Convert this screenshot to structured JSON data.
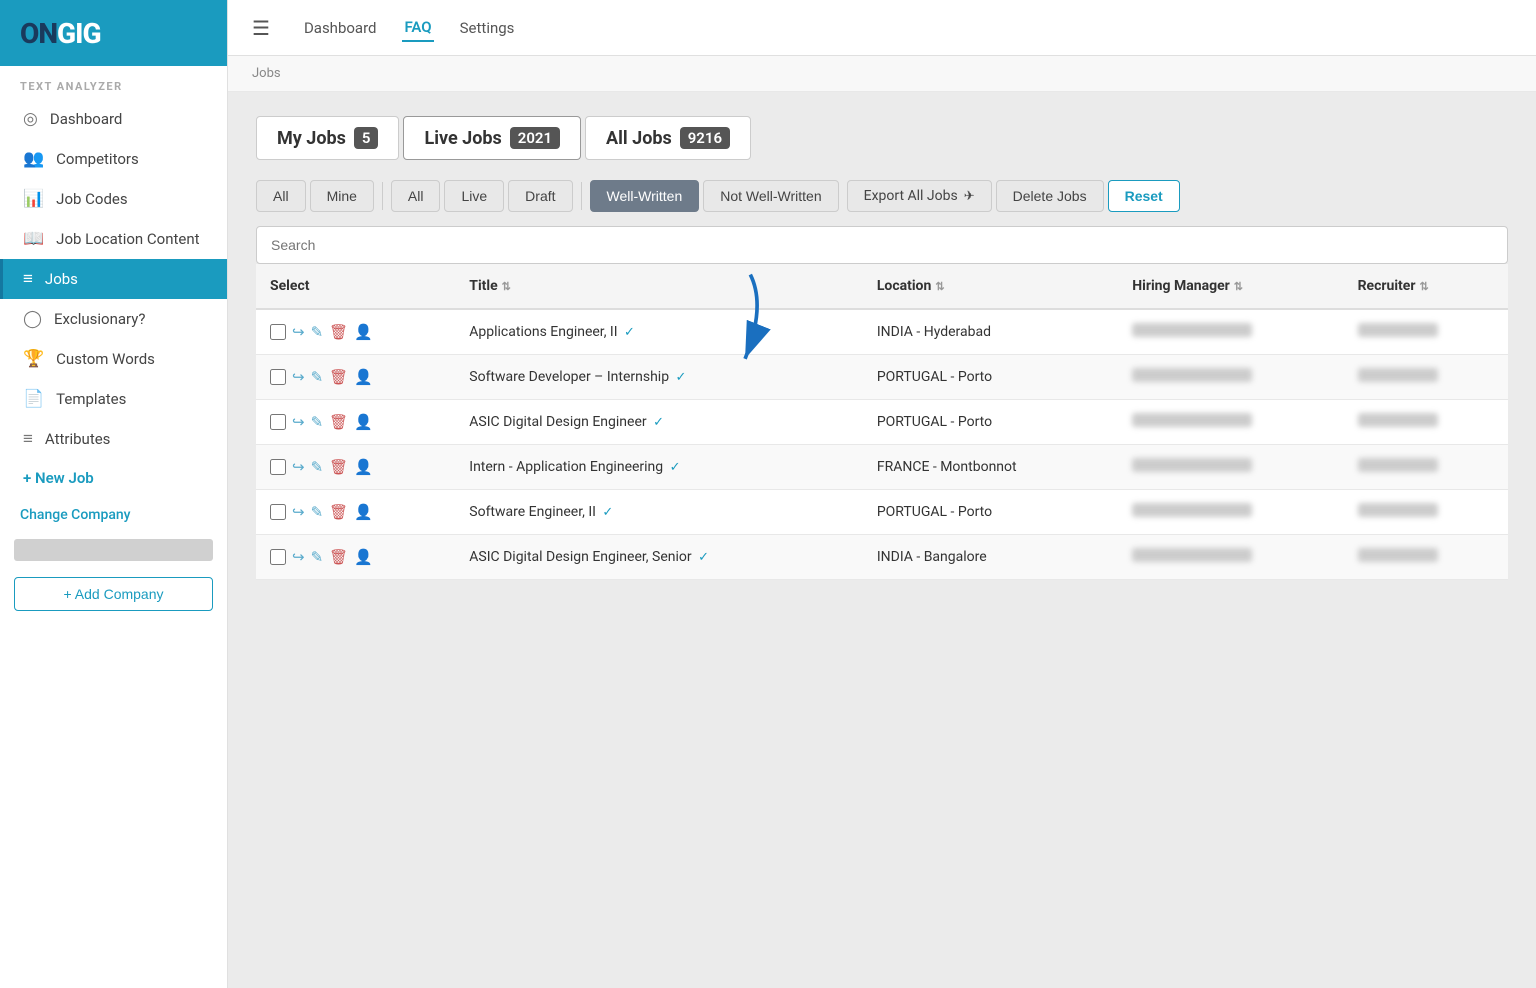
{
  "sidebar": {
    "logo": "ONGIG",
    "logo_on": "ON",
    "logo_gig": "GIG",
    "section_label": "TEXT ANALYZER",
    "items": [
      {
        "id": "dashboard",
        "label": "Dashboard",
        "icon": "◎",
        "active": false
      },
      {
        "id": "competitors",
        "label": "Competitors",
        "icon": "👥",
        "active": false
      },
      {
        "id": "job-codes",
        "label": "Job Codes",
        "icon": "📊",
        "active": false
      },
      {
        "id": "job-location-content",
        "label": "Job Location Content",
        "icon": "📖",
        "active": false
      },
      {
        "id": "jobs",
        "label": "Jobs",
        "icon": "≡",
        "active": true
      },
      {
        "id": "exclusionary",
        "label": "Exclusionary?",
        "icon": "◯",
        "active": false
      },
      {
        "id": "custom-words",
        "label": "Custom Words",
        "icon": "🏆",
        "active": false
      },
      {
        "id": "templates",
        "label": "Templates",
        "icon": "📄",
        "active": false
      },
      {
        "id": "attributes",
        "label": "Attributes",
        "icon": "≡",
        "active": false
      }
    ],
    "new_job_label": "+ New Job",
    "change_company_label": "Change Company",
    "add_company_label": "+ Add Company"
  },
  "topnav": {
    "links": [
      {
        "id": "dashboard",
        "label": "Dashboard",
        "active": false
      },
      {
        "id": "faq",
        "label": "FAQ",
        "active": true
      },
      {
        "id": "settings",
        "label": "Settings",
        "active": false
      }
    ]
  },
  "breadcrumb": "Jobs",
  "content": {
    "tabs": [
      {
        "id": "my-jobs",
        "label": "My Jobs",
        "badge": "5"
      },
      {
        "id": "live-jobs",
        "label": "Live Jobs",
        "badge": "2021"
      },
      {
        "id": "all-jobs",
        "label": "All Jobs",
        "badge": "9216"
      }
    ],
    "filters": {
      "group1": [
        "All",
        "Mine"
      ],
      "group2": [
        "All",
        "Live",
        "Draft"
      ],
      "group3": [
        "Well-Written",
        "Not Well-Written"
      ],
      "export_label": "Export All Jobs",
      "delete_label": "Delete Jobs",
      "reset_label": "Reset"
    },
    "search_placeholder": "Search",
    "table": {
      "columns": [
        "Select",
        "Title",
        "Location",
        "Hiring Manager",
        "Recruiter"
      ],
      "rows": [
        {
          "id": 1,
          "title": "Applications Engineer, II",
          "check": true,
          "location": "INDIA - Hyderabad",
          "hiring_manager": "",
          "recruiter": ""
        },
        {
          "id": 2,
          "title": "Software Developer – Internship",
          "check": true,
          "location": "PORTUGAL - Porto",
          "hiring_manager": "",
          "recruiter": ""
        },
        {
          "id": 3,
          "title": "ASIC Digital Design Engineer",
          "check": true,
          "location": "PORTUGAL - Porto",
          "hiring_manager": "",
          "recruiter": ""
        },
        {
          "id": 4,
          "title": "Intern - Application Engineering",
          "check": true,
          "location": "FRANCE - Montbonnot",
          "hiring_manager": "",
          "recruiter": ""
        },
        {
          "id": 5,
          "title": "Software Engineer, II",
          "check": true,
          "location": "PORTUGAL - Porto",
          "hiring_manager": "",
          "recruiter": ""
        },
        {
          "id": 6,
          "title": "ASIC Digital Design Engineer, Senior",
          "check": true,
          "location": "INDIA - Bangalore",
          "hiring_manager": "",
          "recruiter": ""
        }
      ]
    }
  }
}
